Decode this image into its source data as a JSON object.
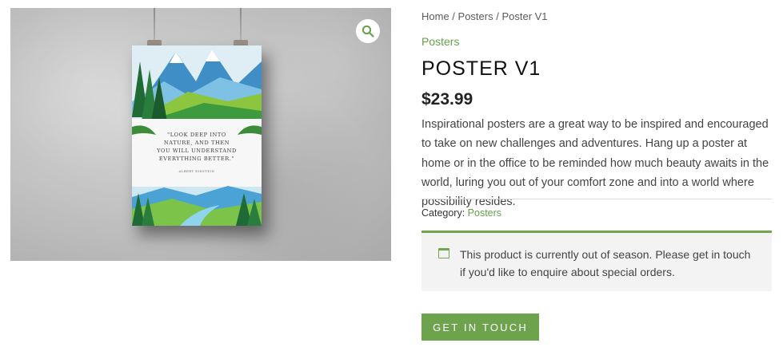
{
  "gallery": {
    "zoom_icon": "magnifier-icon",
    "poster": {
      "quote_lines": [
        "\"LOOK DEEP INTO",
        "NATURE, AND THEN",
        "YOU WILL UNDERSTAND",
        "EVERYTHING BETTER.\""
      ],
      "author": "ALBERT EINSTEIN"
    }
  },
  "breadcrumb": {
    "home": "Home",
    "sep1": " / ",
    "section": "Posters",
    "sep2": " / ",
    "current": "Poster V1"
  },
  "product": {
    "category_link": "Posters",
    "title": "POSTER V1",
    "price": "$23.99",
    "description": "Inspirational posters are a great way to be inspired and encouraged to take on new challenges and adventures. Hang up a poster at home or in the office to be reminded how much beauty awaits in the world, luring you out of your comfort zone and into a world where possibility resides.",
    "category_label": "Category: ",
    "category_value": "Posters"
  },
  "notice": {
    "icon": "calendar-icon",
    "text": "This product is currently out of season. Please get in touch if you'd like to enquire about special orders."
  },
  "cta": {
    "label": "GET IN TOUCH"
  },
  "colors": {
    "accent": "#6da34d",
    "notice_bg": "#f3f3f3"
  }
}
